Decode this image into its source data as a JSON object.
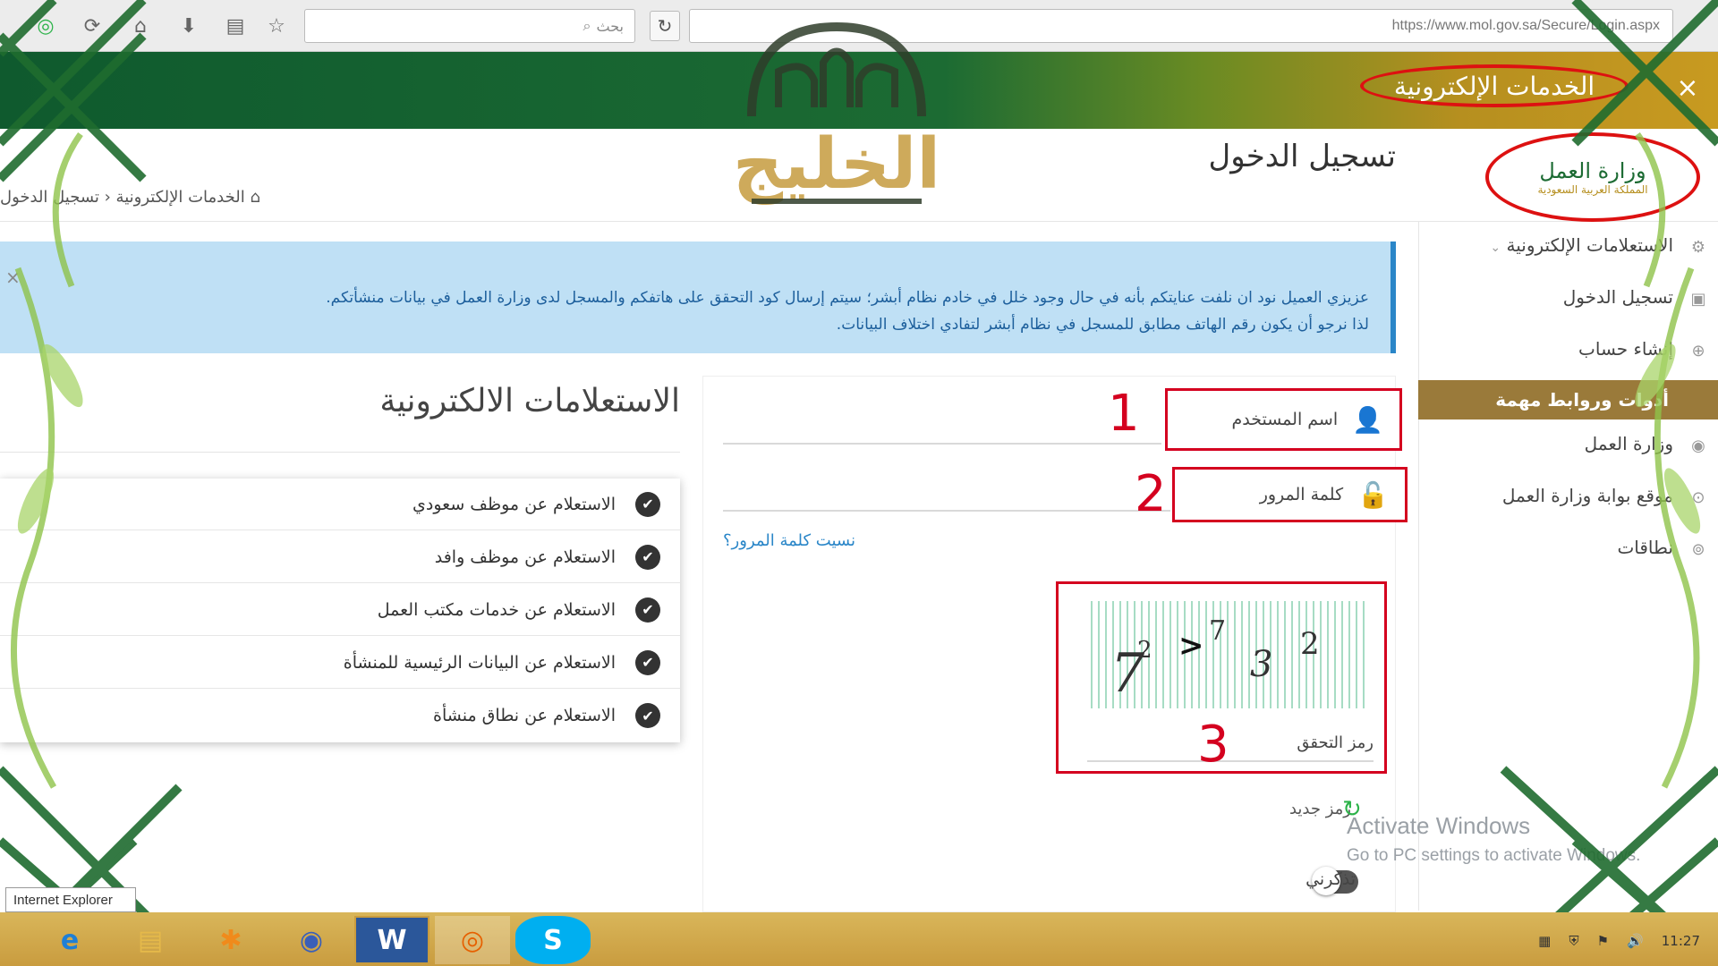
{
  "browser": {
    "search_placeholder": "بحث",
    "url": "https://www.mol.gov.sa/Secure/Login.aspx"
  },
  "header": {
    "title": "الخدمات الإلكترونية",
    "close": "×"
  },
  "ministry": {
    "name": "وزارة العمل",
    "subtitle": "المملكة العربية السعودية"
  },
  "watermark": {
    "text": "الخليج"
  },
  "page": {
    "title": "تسجيل الدخول",
    "breadcrumb": "الخدمات الإلكترونية ‹ تسجيل الدخول"
  },
  "notice": {
    "line1": "عزيزي العميل نود ان نلفت عنايتكم بأنه في حال وجود خلل في خادم نظام أبشر؛ سيتم إرسال كود التحقق على هاتفكم والمسجل لدى وزارة العمل في بيانات منشأتكم.",
    "line2": "لذا نرجو أن يكون رقم الهاتف مطابق للمسجل في نظام أبشر لتفادي اختلاف البيانات.",
    "close": "×"
  },
  "sidemenu": {
    "items": [
      {
        "label": "الاستعلامات الإلكترونية",
        "icon": "gears-icon"
      },
      {
        "label": "تسجيل الدخول",
        "icon": "login-icon"
      },
      {
        "label": "إنشاء حساب",
        "icon": "plus-icon"
      }
    ],
    "highlight": "أدوات وروابط مهمة",
    "links": [
      {
        "label": "وزارة العمل",
        "icon": "globe-icon"
      },
      {
        "label": "موقع بوابة وزارة العمل",
        "icon": "link-icon"
      },
      {
        "label": "نطاقات",
        "icon": "circle-icon"
      }
    ]
  },
  "login": {
    "username_label": "اسم المستخدم",
    "password_label": "كلمة المرور",
    "forgot": "نسيت كلمة المرور؟",
    "captcha_label": "رمز التحقق",
    "captcha_chars": [
      "7",
      "2",
      ">",
      "7",
      "3",
      "2"
    ],
    "new_code": "رمز جديد",
    "remember": "تذكرني",
    "markers": [
      "1",
      "2",
      "3"
    ]
  },
  "inquiries": {
    "title": "الاستعلامات الالكترونية",
    "items": [
      "الاستعلام عن موظف سعودي",
      "الاستعلام عن موظف وافد",
      "الاستعلام عن خدمات مكتب العمل",
      "الاستعلام عن البيانات الرئيسية للمنشأة",
      "الاستعلام عن نطاق منشأة"
    ]
  },
  "windows": {
    "activate": "Activate Windows",
    "activate_sub": "Go to PC settings to activate Windows.",
    "ie_label": "Internet Explorer",
    "clock": "11:27"
  },
  "taskbar": {
    "apps": [
      {
        "name": "ie-icon",
        "glyph": "e"
      },
      {
        "name": "explorer-icon",
        "glyph": "▤"
      },
      {
        "name": "vlc-icon",
        "glyph": "✱"
      },
      {
        "name": "browser-icon",
        "glyph": "◉"
      },
      {
        "name": "word-icon",
        "glyph": "W"
      },
      {
        "name": "firefox-icon",
        "glyph": "◎"
      },
      {
        "name": "skype-icon",
        "glyph": "S"
      }
    ]
  },
  "colors": {
    "brand_green": "#1c6b33",
    "brand_gold": "#c89a20",
    "annotation_red": "#d4001f",
    "notice_bg": "#bfe0f5",
    "link_blue": "#2a86c8"
  }
}
